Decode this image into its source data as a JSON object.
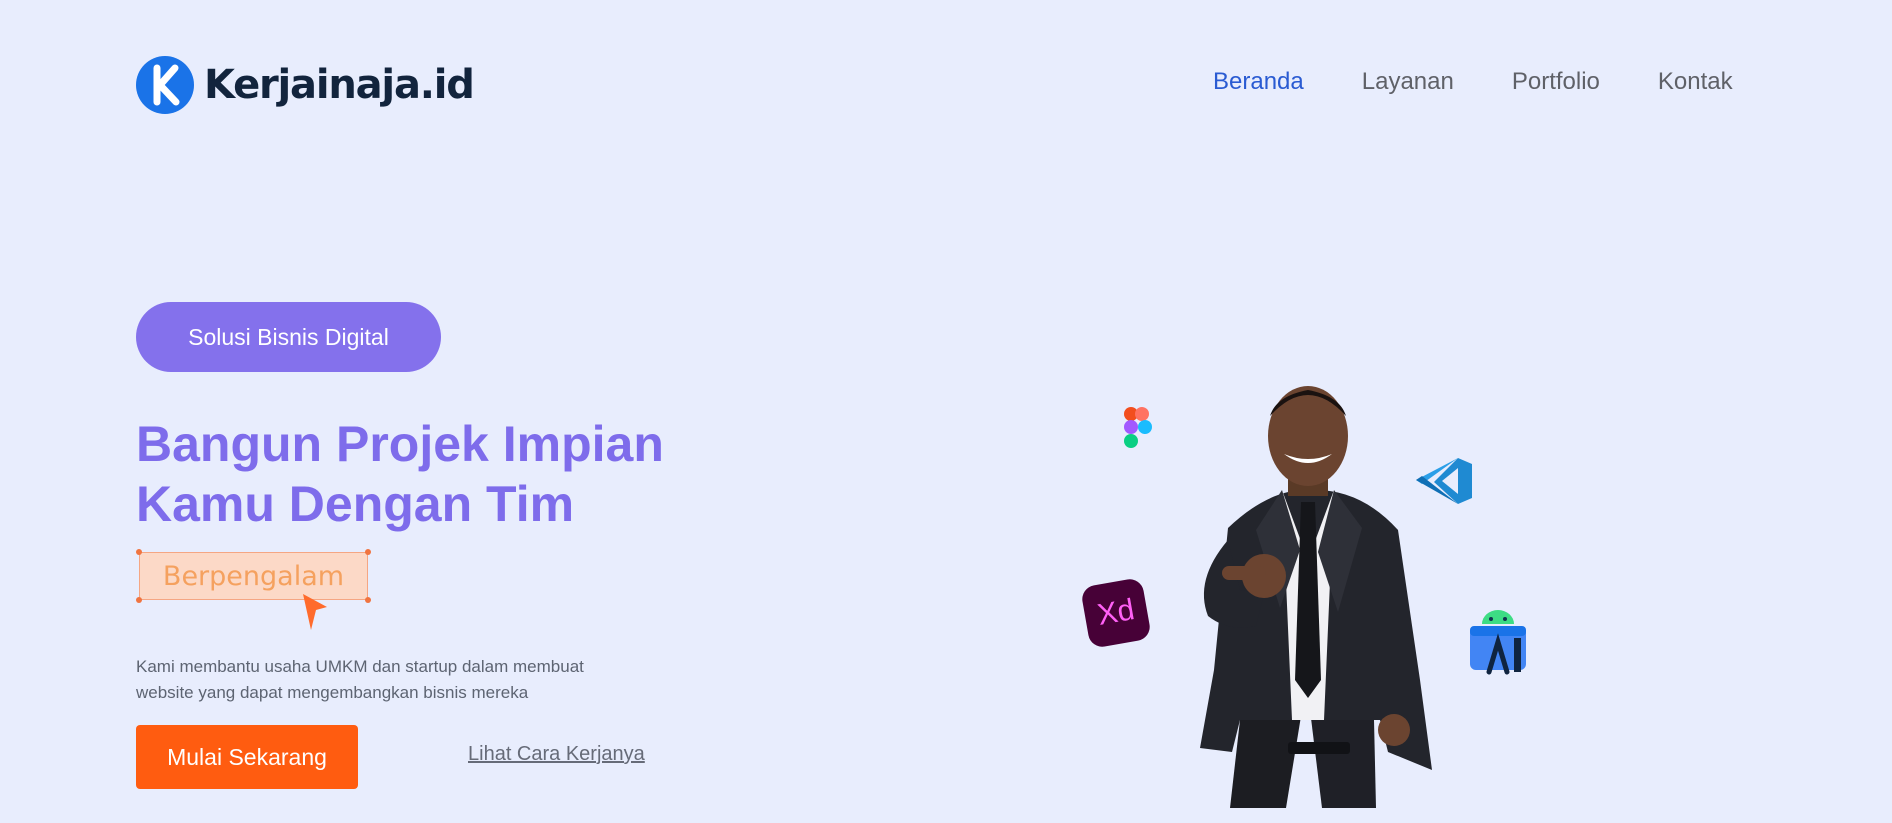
{
  "header": {
    "logo_text": "Kerjainaja.id",
    "nav": [
      {
        "label": "Beranda",
        "active": true
      },
      {
        "label": "Layanan",
        "active": false
      },
      {
        "label": "Portfolio",
        "active": false
      },
      {
        "label": "Kontak",
        "active": false
      }
    ]
  },
  "hero": {
    "badge_label": "Solusi Bisnis Digital",
    "headline_line1": "Bangun Projek Impian",
    "headline_line2": "Kamu Dengan Tim",
    "highlight_word": "Berpengalam",
    "description_line1": "Kami membantu usaha UMKM dan startup dalam membuat",
    "description_line2": "website yang dapat mengembangkan bisnis mereka",
    "cta_label": "Mulai Sekarang",
    "secondary_link_label": "Lihat Cara Kerjanya",
    "illustration": {
      "subject": "person-pointing-illustration",
      "floating_icons": [
        "figma-icon",
        "vscode-icon",
        "adobe-xd-icon",
        "android-studio-icon"
      ],
      "xd_icon_text": "Xd"
    }
  },
  "colors": {
    "background": "#e8edfd",
    "brand_blue": "#1a73e8",
    "nav_active": "#2a5bd2",
    "accent_purple": "#8471ec",
    "cta_orange": "#ff5c10",
    "highlight_bg": "#fcd9c7"
  }
}
